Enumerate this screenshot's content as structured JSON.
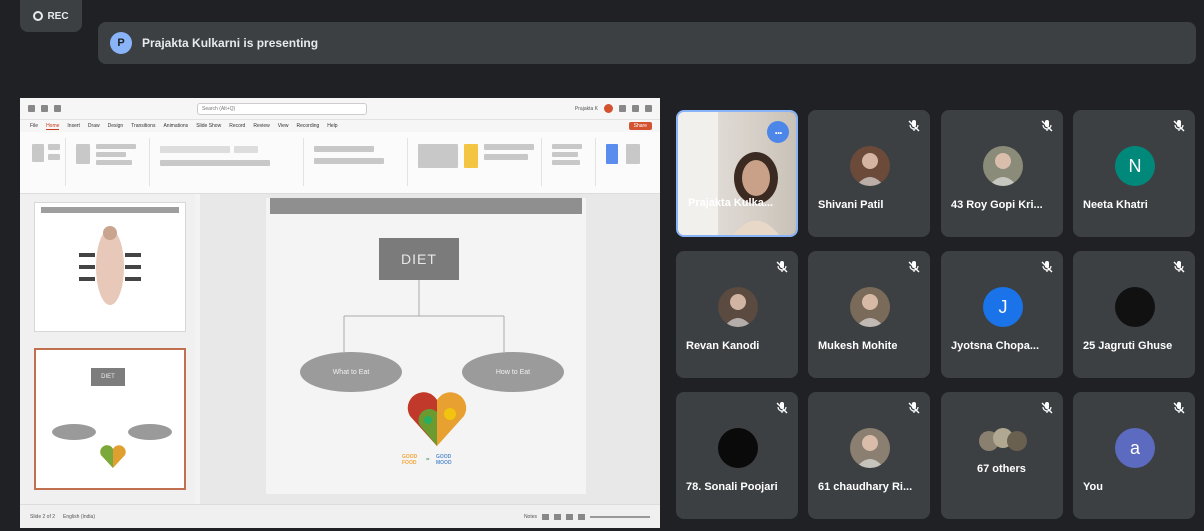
{
  "recording": {
    "label": "REC"
  },
  "presenting": {
    "avatar_letter": "P",
    "text": "Prajakta Kulkarni is presenting"
  },
  "presentation": {
    "search_placeholder": "Search (Alt+Q)",
    "user_label": "Prajakta K",
    "menu": [
      "File",
      "Home",
      "Insert",
      "Draw",
      "Design",
      "Transitions",
      "Animations",
      "Slide Show",
      "Record",
      "Review",
      "View",
      "Recording",
      "Help"
    ],
    "active_menu": "Home",
    "share_label": "Share",
    "slide": {
      "title_box": "DIET",
      "left_oval": "What to Eat",
      "right_oval": "How to Eat",
      "good_food_line1": "GOOD",
      "good_food_line2": "FOOD",
      "good_mood_line1": "GOOD",
      "good_mood_line2": "MOOD"
    },
    "thumb_title": "DIET",
    "status_left": "Slide 2 of 2",
    "status_lang": "English (India)",
    "status_zoom": "Notes"
  },
  "tiles": [
    {
      "name": "Prajakta Kulka...",
      "type": "video",
      "speaking": true
    },
    {
      "name": "Shivani Patil",
      "type": "photo",
      "avatar_color": "#6b4a3a"
    },
    {
      "name": "43 Roy Gopi Kri...",
      "type": "photo",
      "avatar_color": "#8b8b7a"
    },
    {
      "name": "Neeta Khatri",
      "type": "letter",
      "letter": "N",
      "avatar_color": "#00897b"
    },
    {
      "name": "Revan Kanodi",
      "type": "photo",
      "avatar_color": "#5a4a40"
    },
    {
      "name": "Mukesh Mohite",
      "type": "photo",
      "avatar_color": "#7a6a5a"
    },
    {
      "name": "Jyotsna Chopa...",
      "type": "letter",
      "letter": "J",
      "avatar_color": "#1a73e8"
    },
    {
      "name": "25 Jagruti Ghuse",
      "type": "photo",
      "avatar_color": "#111111"
    },
    {
      "name": "78. Sonali Poojari",
      "type": "photo",
      "avatar_color": "#0a0a0a"
    },
    {
      "name": "61 chaudhary Ri...",
      "type": "photo",
      "avatar_color": "#8a7f70"
    },
    {
      "name": "67 others",
      "type": "others",
      "avatar_color": "#9a9080"
    },
    {
      "name": "You",
      "type": "letter",
      "letter": "a",
      "avatar_color": "#5c6bc0"
    }
  ],
  "colors": {
    "background": "#202124",
    "tile": "#3c4043",
    "accent": "#8ab4f8",
    "ppt_accent": "#d35230"
  }
}
